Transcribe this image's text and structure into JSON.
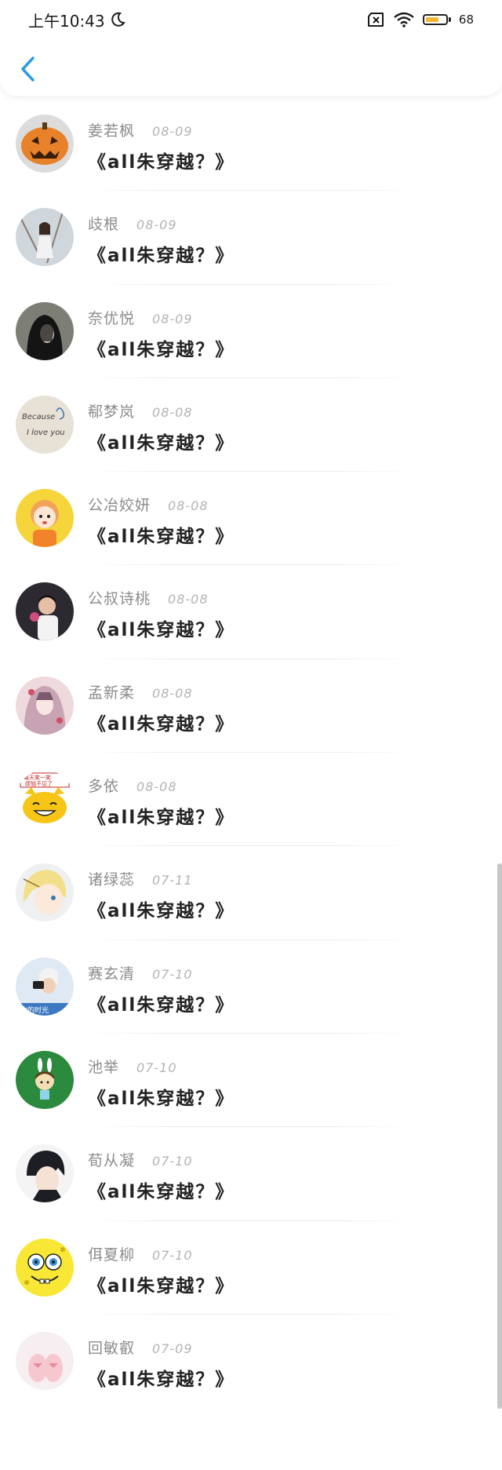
{
  "status_bar": {
    "time": "上午10:43",
    "battery_level": "68",
    "battery_fraction": 0.68,
    "icons": [
      "moon-icon",
      "sim-blocked-icon",
      "wifi-icon",
      "battery-icon"
    ]
  },
  "header": {
    "back_icon": "chevron-left-icon",
    "accent_color": "#2f9be0"
  },
  "comments": [
    {
      "user": "姜若枫",
      "date": "08-09",
      "title": "《all朱穿越？》",
      "avatar": "pumpkin-avatar"
    },
    {
      "user": "歧根",
      "date": "08-09",
      "title": "《all朱穿越？》",
      "avatar": "girl-photo-avatar"
    },
    {
      "user": "奈优悦",
      "date": "08-09",
      "title": "《all朱穿越？》",
      "avatar": "dark-hair-avatar"
    },
    {
      "user": "郗梦岚",
      "date": "08-08",
      "title": "《all朱穿越？》",
      "avatar": "handwriting-avatar"
    },
    {
      "user": "公冶姣妍",
      "date": "08-08",
      "title": "《all朱穿越？》",
      "avatar": "cartoon-orange-avatar"
    },
    {
      "user": "公叔诗桃",
      "date": "08-08",
      "title": "《all朱穿越？》",
      "avatar": "kid-photo-avatar"
    },
    {
      "user": "孟新柔",
      "date": "08-08",
      "title": "《all朱穿越？》",
      "avatar": "anime-girl-avatar"
    },
    {
      "user": "多依",
      "date": "08-08",
      "title": "《all朱穿越？》",
      "avatar": "yellow-cat-avatar"
    },
    {
      "user": "诸绿蕊",
      "date": "07-11",
      "title": "《all朱穿越？》",
      "avatar": "anime-blonde-avatar"
    },
    {
      "user": "赛玄清",
      "date": "07-10",
      "title": "《all朱穿越？》",
      "avatar": "camera-girl-avatar"
    },
    {
      "user": "池举",
      "date": "07-10",
      "title": "《all朱穿越？》",
      "avatar": "bunny-green-avatar"
    },
    {
      "user": "荀从凝",
      "date": "07-10",
      "title": "《all朱穿越？》",
      "avatar": "anime-boy-avatar"
    },
    {
      "user": "佴夏柳",
      "date": "07-10",
      "title": "《all朱穿越？》",
      "avatar": "spongebob-avatar"
    },
    {
      "user": "回敏叡",
      "date": "07-09",
      "title": "《all朱穿越？》",
      "avatar": "pink-slippers-avatar"
    }
  ]
}
